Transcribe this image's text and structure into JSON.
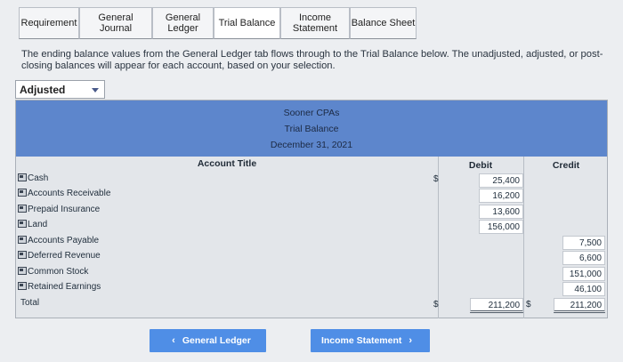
{
  "tabs": [
    {
      "label": "Requirement"
    },
    {
      "label": "General\nJournal"
    },
    {
      "label": "General\nLedger"
    },
    {
      "label": "Trial Balance"
    },
    {
      "label": "Income\nStatement"
    },
    {
      "label": "Balance Sheet"
    }
  ],
  "instructions": "The ending balance values from the General Ledger tab flows through to the Trial Balance below. The unadjusted, adjusted, or post-closing balances will appear for each account, based on your selection.",
  "dropdown": {
    "selected": "Adjusted",
    "icon": "chevron-down-icon"
  },
  "trial_balance": {
    "company": "Sooner CPAs",
    "title": "Trial Balance",
    "date": "December 31, 2021",
    "col_account": "Account Title",
    "col_debit": "Debit",
    "col_credit": "Credit",
    "currency_symbol": "$",
    "accounts": [
      {
        "name": "Cash",
        "debit": "25,400",
        "credit": ""
      },
      {
        "name": "Accounts Receivable",
        "debit": "16,200",
        "credit": ""
      },
      {
        "name": "Prepaid Insurance",
        "debit": "13,600",
        "credit": ""
      },
      {
        "name": "Land",
        "debit": "156,000",
        "credit": ""
      },
      {
        "name": "Accounts Payable",
        "debit": "",
        "credit": "7,500"
      },
      {
        "name": "Deferred Revenue",
        "debit": "",
        "credit": "6,600"
      },
      {
        "name": "Common Stock",
        "debit": "",
        "credit": "151,000"
      },
      {
        "name": "Retained Earnings",
        "debit": "",
        "credit": "46,100"
      }
    ],
    "total_label": "Total",
    "total_debit": "211,200",
    "total_credit": "211,200"
  },
  "nav": {
    "prev_label": "General Ledger",
    "next_label": "Income Statement",
    "prev_icon": "chevron-left-icon",
    "next_icon": "chevron-right-icon",
    "button_color": "#4f8ee6"
  }
}
